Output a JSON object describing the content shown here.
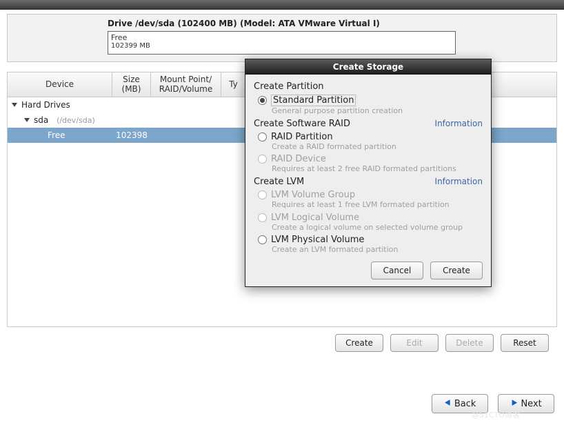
{
  "drive": {
    "title": "Drive /dev/sda (102400 MB) (Model: ATA VMware Virtual I)",
    "free_label": "Free",
    "free_size": "102399 MB"
  },
  "table": {
    "headers": {
      "device": "Device",
      "size": "Size\n(MB)",
      "mount": "Mount Point/\nRAID/Volume",
      "type": "Ty"
    },
    "rows": {
      "hard_drives": "Hard Drives",
      "sda": "sda",
      "sda_path": "(/dev/sda)",
      "free": "Free",
      "free_size": "102398"
    }
  },
  "main_buttons": {
    "create": "Create",
    "edit": "Edit",
    "delete": "Delete",
    "reset": "Reset"
  },
  "nav": {
    "back": "Back",
    "next": "Next"
  },
  "dialog": {
    "title": "Create Storage",
    "section_partition": "Create Partition",
    "opt_standard": "Standard Partition",
    "hint_standard": "General purpose partition creation",
    "section_raid": "Create Software RAID",
    "info": "Information",
    "opt_raid_partition": "RAID Partition",
    "hint_raid_partition": "Create a RAID formated partition",
    "opt_raid_device": "RAID Device",
    "hint_raid_device": "Requires at least 2 free RAID formated partitions",
    "section_lvm": "Create LVM",
    "opt_lvm_vg": "LVM Volume Group",
    "hint_lvm_vg": "Requires at least 1 free LVM formated partition",
    "opt_lvm_lv": "LVM Logical Volume",
    "hint_lvm_lv": "Create a logical volume on selected volume group",
    "opt_lvm_pv": "LVM Physical Volume",
    "hint_lvm_pv": "Create an LVM formated partition",
    "cancel": "Cancel",
    "create": "Create"
  },
  "watermark": "@51CTO博客"
}
